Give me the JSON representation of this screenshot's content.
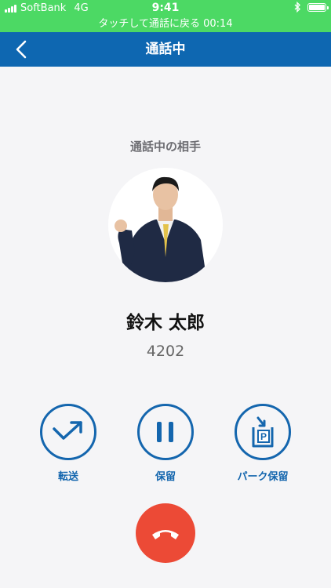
{
  "status_bar": {
    "carrier": "SoftBank",
    "network": "4G",
    "time": "9:41",
    "bluetooth_icon": "bluetooth-icon",
    "battery_level": 0.9
  },
  "banner": {
    "text": "タッチして通話に戻る 00:14"
  },
  "nav": {
    "title": "通話中",
    "back_icon": "chevron-left-icon"
  },
  "call": {
    "section_label": "通話中の相手",
    "name": "鈴木 太郎",
    "number": "4202"
  },
  "actions": [
    {
      "label": "転送",
      "icon": "transfer-arrow-icon"
    },
    {
      "label": "保留",
      "icon": "pause-icon"
    },
    {
      "label": "パーク保留",
      "icon": "park-hold-icon"
    }
  ],
  "hangup": {
    "icon": "phone-hangup-icon"
  },
  "colors": {
    "status_green": "#4cd964",
    "nav_blue": "#0e67b1",
    "action_blue": "#1466ae",
    "hangup_red": "#ec4a36",
    "background": "#f5f5f7"
  }
}
